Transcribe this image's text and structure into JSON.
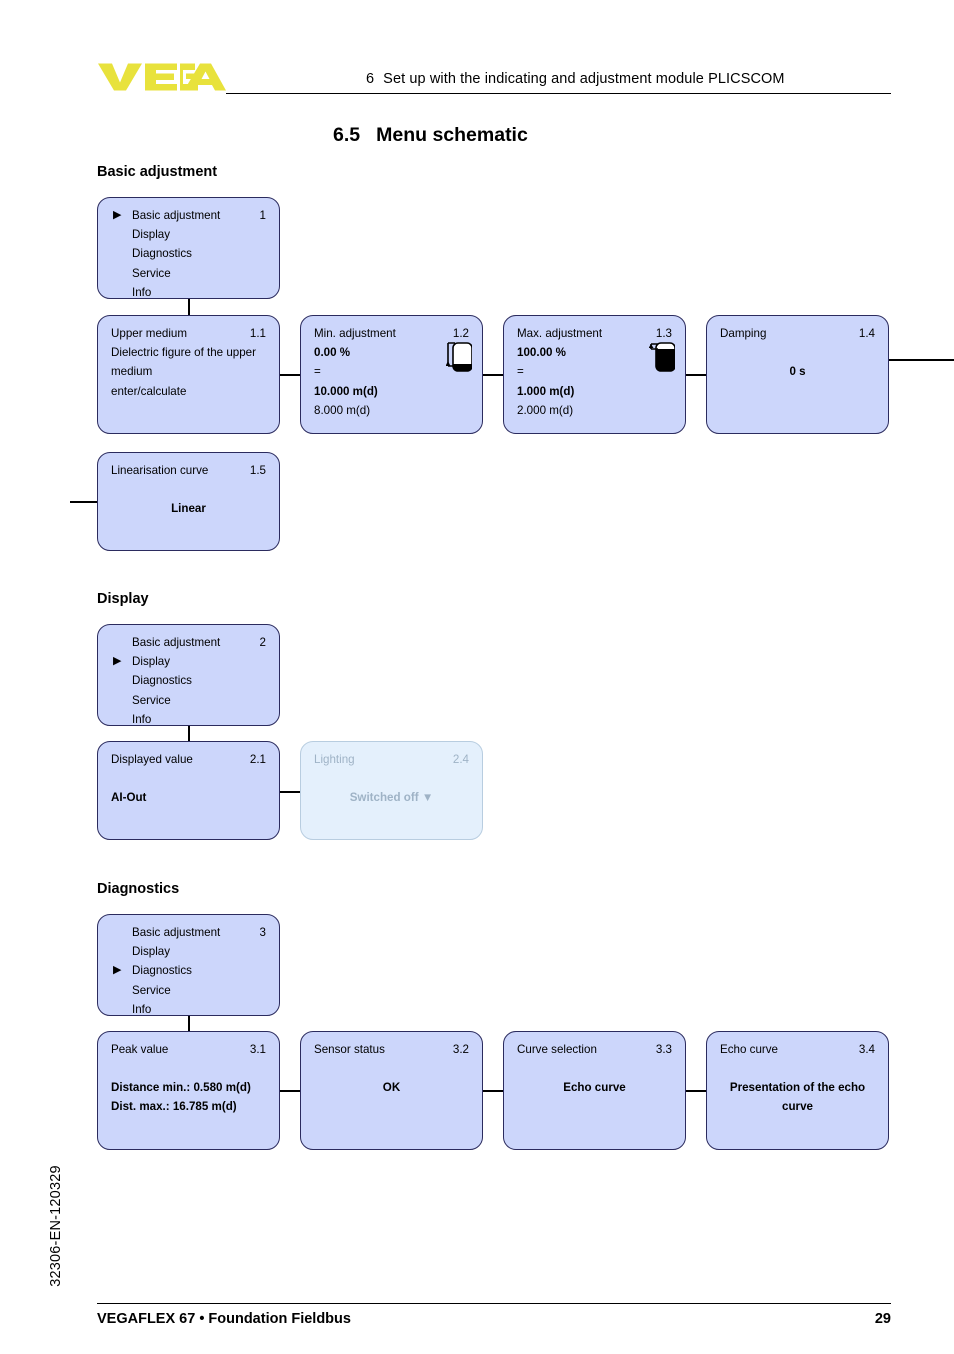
{
  "header": {
    "logo_text": "VEGA",
    "logo_color": "#e8e23c",
    "chapter_number": "6",
    "chapter_text": "Set up with the indicating and adjustment module PLICSCOM"
  },
  "section": {
    "number": "6.5",
    "title": "Menu schematic"
  },
  "groups": {
    "basic": "Basic adjustment",
    "display": "Display",
    "diagnostics": "Diagnostics"
  },
  "menu_items": {
    "basic_adjustment": "Basic adjustment",
    "display": "Display",
    "diagnostics": "Diagnostics",
    "service": "Service",
    "info": "Info",
    "marker": "▶"
  },
  "menu_nodes": {
    "basic": {
      "index": "1"
    },
    "display": {
      "index": "2"
    },
    "diagnostics": {
      "index": "3"
    }
  },
  "nodes": {
    "upper_medium": {
      "title": "Upper medium",
      "index": "1.1",
      "line1": "Dielectric figure of the upper",
      "line2": "medium",
      "line3": "enter/calculate"
    },
    "min_adjustment": {
      "title": "Min. adjustment",
      "index": "1.2",
      "percent": "0.00 %",
      "equals": "=",
      "value_bold": "10.000 m(d)",
      "value_plain": "8.000 m(d)",
      "icon": "tank-min-icon"
    },
    "max_adjustment": {
      "title": "Max. adjustment",
      "index": "1.3",
      "percent": "100.00 %",
      "equals": "=",
      "value_bold": "1.000 m(d)",
      "value_plain": "2.000 m(d)",
      "icon": "tank-max-icon"
    },
    "damping": {
      "title": "Damping",
      "index": "1.4",
      "value": "0 s"
    },
    "linearisation_curve": {
      "title": "Linearisation curve",
      "index": "1.5",
      "value": "Linear"
    },
    "displayed_value": {
      "title": "Displayed value",
      "index": "2.1",
      "value": "AI-Out"
    },
    "lighting": {
      "title": "Lighting",
      "index": "2.4",
      "value": "Switched off ▼"
    },
    "peak_value": {
      "title": "Peak value",
      "index": "3.1",
      "line1": "Distance min.: 0.580 m(d)",
      "line2": "Dist. max.: 16.785 m(d)"
    },
    "sensor_status": {
      "title": "Sensor status",
      "index": "3.2",
      "value": "OK"
    },
    "curve_selection": {
      "title": "Curve selection",
      "index": "3.3",
      "value": "Echo curve"
    },
    "echo_curve": {
      "title": "Echo curve",
      "index": "3.4",
      "value": "Presentation of the echo curve"
    }
  },
  "footer": {
    "product": "VEGAFLEX 67",
    "separator": "•",
    "protocol": "Foundation Fieldbus",
    "page": "29",
    "document_code": "32306-EN-120329"
  },
  "colors": {
    "node_fill": "#ccd6fb",
    "node_border": "#2b2b5e",
    "node_fill_faded": "#e4f0fc",
    "node_border_faded": "#b8cde0",
    "brand": "#e8e23c"
  }
}
